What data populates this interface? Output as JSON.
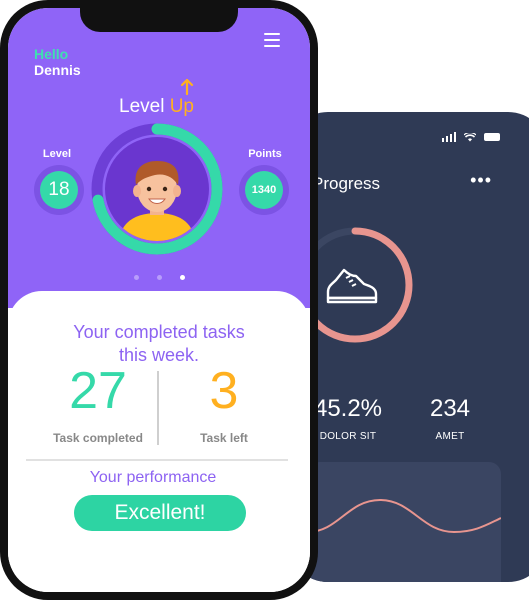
{
  "back_phone": {
    "title": "Progress",
    "more_glyph": "•••",
    "ring_progress": 0.78,
    "stats": [
      {
        "value": "45.2%",
        "label": "DOLOR SIT"
      },
      {
        "value": "234",
        "label": "AMET"
      }
    ],
    "colors": {
      "bg": "#2f3a55",
      "ring": "#e8958f",
      "card": "#3a4562"
    },
    "icons": [
      "signal-icon",
      "wifi-icon",
      "battery-icon",
      "shoe-icon"
    ]
  },
  "front_phone": {
    "greeting": {
      "hello": "Hello",
      "name": "Dennis"
    },
    "header": {
      "level": "Level ",
      "up": "Up"
    },
    "level": {
      "label": "Level",
      "value": "18"
    },
    "points": {
      "label": "Points",
      "value": "1340"
    },
    "avatar_progress": 0.72,
    "pager": {
      "count": 3,
      "active": 2
    },
    "card": {
      "title_line1": "Your completed tasks",
      "title_line2": "this week.",
      "completed": {
        "value": "27",
        "label": "Task completed"
      },
      "left": {
        "value": "3",
        "label": "Task left"
      },
      "performance_label": "Your performance",
      "performance_value": "Excellent!"
    },
    "colors": {
      "primary": "#8f64f7",
      "accent": "#35d9a9",
      "highlight": "#ffb020",
      "text_purple": "#8d63f2"
    },
    "icons": [
      "menu-icon",
      "arrow-up-icon",
      "avatar"
    ]
  }
}
